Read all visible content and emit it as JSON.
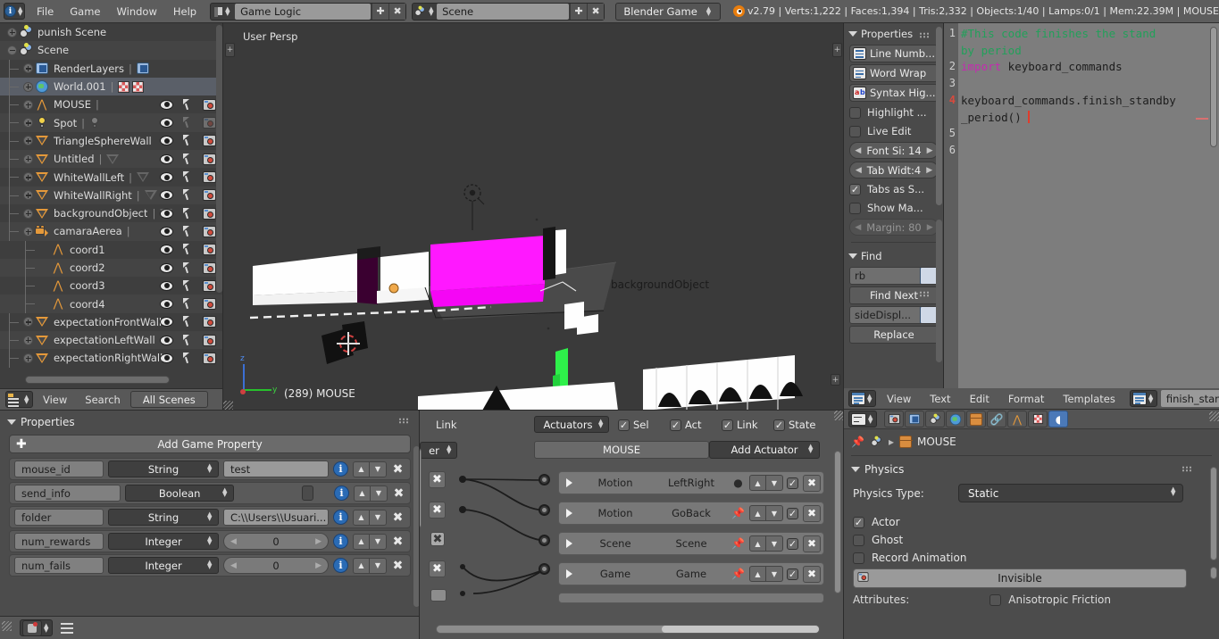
{
  "topbar": {
    "menus": [
      "File",
      "Game",
      "Window",
      "Help"
    ],
    "screen_layout": "Game Logic",
    "scene": "Scene",
    "engine": "Blender Game",
    "stats": "v2.79 | Verts:1,222 | Faces:1,394 | Tris:2,332 | Objects:1/40 | Lamps:0/1 | Mem:22.39M | MOUSE"
  },
  "outliner": {
    "rows": [
      {
        "label": "punish Scene",
        "indent": 0,
        "icon": "scene-icon",
        "expand": "closed",
        "selected": false,
        "eye": false
      },
      {
        "label": "Scene",
        "indent": 0,
        "icon": "scene-icon",
        "expand": "open",
        "selected": false,
        "eye": false
      },
      {
        "label": "RenderLayers",
        "indent": 1,
        "icon": "renderlayer-icon",
        "expand": "closed",
        "selected": false,
        "eye": false,
        "sub": "renderlayer"
      },
      {
        "label": "World.001",
        "indent": 1,
        "icon": "world-icon",
        "expand": "closed",
        "selected": true,
        "eye": false,
        "sub": "checker"
      },
      {
        "label": "MOUSE",
        "indent": 1,
        "icon": "armature-icon",
        "expand": "closed",
        "selected": false,
        "eye": true,
        "sub": "cameras"
      },
      {
        "label": "Spot",
        "indent": 1,
        "icon": "lamp-icon",
        "expand": "closed",
        "selected": false,
        "eye": true,
        "sub": "spot",
        "dimRight": true
      },
      {
        "label": "TriangleSphereWall",
        "indent": 1,
        "icon": "mesh-icon",
        "expand": "closed",
        "selected": false,
        "eye": true
      },
      {
        "label": "Untitled",
        "indent": 1,
        "icon": "mesh-icon",
        "expand": "closed",
        "selected": false,
        "eye": true,
        "sub": "mesh"
      },
      {
        "label": "WhiteWallLeft",
        "indent": 1,
        "icon": "mesh-icon",
        "expand": "closed",
        "selected": false,
        "eye": true,
        "sub": "mesh"
      },
      {
        "label": "WhiteWallRight",
        "indent": 1,
        "icon": "mesh-icon",
        "expand": "closed",
        "selected": false,
        "eye": true,
        "sub": "mesh"
      },
      {
        "label": "backgroundObject",
        "indent": 1,
        "icon": "mesh-icon",
        "expand": "closed",
        "selected": false,
        "eye": true,
        "sub": "mesh"
      },
      {
        "label": "camaraAerea",
        "indent": 1,
        "icon": "camera-icon",
        "expand": "closed",
        "selected": false,
        "eye": true,
        "sub": "camdata"
      },
      {
        "label": "coord1",
        "indent": 2,
        "icon": "empty-icon",
        "expand": "none",
        "selected": false,
        "eye": true
      },
      {
        "label": "coord2",
        "indent": 2,
        "icon": "empty-icon",
        "expand": "none",
        "selected": false,
        "eye": true
      },
      {
        "label": "coord3",
        "indent": 2,
        "icon": "empty-icon",
        "expand": "none",
        "selected": false,
        "eye": true
      },
      {
        "label": "coord4",
        "indent": 2,
        "icon": "empty-icon",
        "expand": "none",
        "selected": false,
        "eye": true
      },
      {
        "label": "expectationFrontWall",
        "indent": 1,
        "icon": "mesh-icon",
        "expand": "closed",
        "selected": false,
        "eye": true
      },
      {
        "label": "expectationLeftWall",
        "indent": 1,
        "icon": "mesh-icon",
        "expand": "closed",
        "selected": false,
        "eye": true
      },
      {
        "label": "expectationRightWall",
        "indent": 1,
        "icon": "mesh-icon",
        "expand": "closed",
        "selected": false,
        "eye": true
      }
    ],
    "footer": {
      "view": "View",
      "search": "Search",
      "filter": "All Scenes"
    }
  },
  "viewport": {
    "view_label": "User Persp",
    "active_object": "(289) MOUSE",
    "object_label": "backgroundObject",
    "axis_z": "z",
    "axis_y": "y"
  },
  "text_props": {
    "title": "Properties",
    "line_numbers": "Line Numb...",
    "word_wrap": "Word Wrap",
    "syntax_highlight": "Syntax Hig...",
    "highlight": "Highlight ...",
    "live_edit": "Live Edit",
    "font_size": "Font Si: 14",
    "tab_width": "Tab Widt:4",
    "tabs_as_spaces": "Tabs as S...",
    "show_margin": "Show Ma...",
    "margin": "Margin: 80",
    "find_title": "Find",
    "find_value": "rb",
    "find_next": "Find Next",
    "replace_value": "sideDispl...",
    "replace": "Replace"
  },
  "text_editor": {
    "lines": [
      {
        "no": "1",
        "current": false,
        "segments": [
          {
            "t": "#This code finishes the stand",
            "c": "comment"
          }
        ]
      },
      {
        "no": "",
        "current": false,
        "segments": [
          {
            "t": "by period",
            "c": "comment"
          }
        ]
      },
      {
        "no": "2",
        "current": false,
        "segments": [
          {
            "t": "import",
            "c": "kw"
          },
          {
            "t": " keyboard_commands",
            "c": "plain"
          }
        ]
      },
      {
        "no": "3",
        "current": false,
        "segments": []
      },
      {
        "no": "4",
        "current": true,
        "segments": [
          {
            "t": "keyboard_commands.finish_standby",
            "c": "plain"
          }
        ]
      },
      {
        "no": "",
        "current": false,
        "segments": [
          {
            "t": "_period() ",
            "c": "plain"
          }
        ],
        "caret": true
      },
      {
        "no": "5",
        "current": false,
        "segments": []
      },
      {
        "no": "6",
        "current": false,
        "segments": []
      }
    ]
  },
  "game_props": {
    "title": "Properties",
    "add_button": "Add Game Property",
    "rows": [
      {
        "name": "mouse_id",
        "type": "String",
        "value": "test",
        "kind": "text"
      },
      {
        "name": "send_info",
        "type": "Boolean",
        "value": "",
        "kind": "bool"
      },
      {
        "name": "folder",
        "type": "String",
        "value": "C:\\\\Users\\\\Usuari...",
        "kind": "text"
      },
      {
        "name": "num_rewards",
        "type": "Integer",
        "value": "0",
        "kind": "num"
      },
      {
        "name": "num_fails",
        "type": "Integer",
        "value": "0",
        "kind": "num"
      }
    ]
  },
  "logic": {
    "link_label": "Link",
    "partial_sel": "er",
    "actuators_label": "Actuators",
    "checks": [
      "Sel",
      "Act",
      "Link",
      "State"
    ],
    "object_name": "MOUSE",
    "add_actuator": "Add Actuator",
    "actuators": [
      {
        "type": "Motion",
        "name": "LeftRight",
        "pinned": true
      },
      {
        "type": "Motion",
        "name": "GoBack",
        "pinned": false
      },
      {
        "type": "Scene",
        "name": "Scene",
        "pinned": false
      },
      {
        "type": "Game",
        "name": "Game",
        "pinned": false
      }
    ]
  },
  "physics": {
    "menus": [
      "View",
      "Text",
      "Edit",
      "Format",
      "Templates"
    ],
    "text_datablock": "finish_standby_p",
    "breadcrumb_object": "MOUSE",
    "section_title": "Physics",
    "physics_type_label": "Physics Type:",
    "physics_type_value": "Static",
    "checkboxes": [
      {
        "label": "Actor",
        "checked": true
      },
      {
        "label": "Ghost",
        "checked": false
      },
      {
        "label": "Record Animation",
        "checked": false
      }
    ],
    "invisible": "Invisible",
    "attributes_label": "Attributes:",
    "anisotropic": "Anisotropic Friction"
  },
  "colors": {
    "accent_blue": "#4b79b8",
    "orange": "#e5993a",
    "magenta": "#ff18ff",
    "green": "#27c12c",
    "red": "#d94a3d",
    "panel": "#4c4c4c",
    "header": "#585858"
  }
}
